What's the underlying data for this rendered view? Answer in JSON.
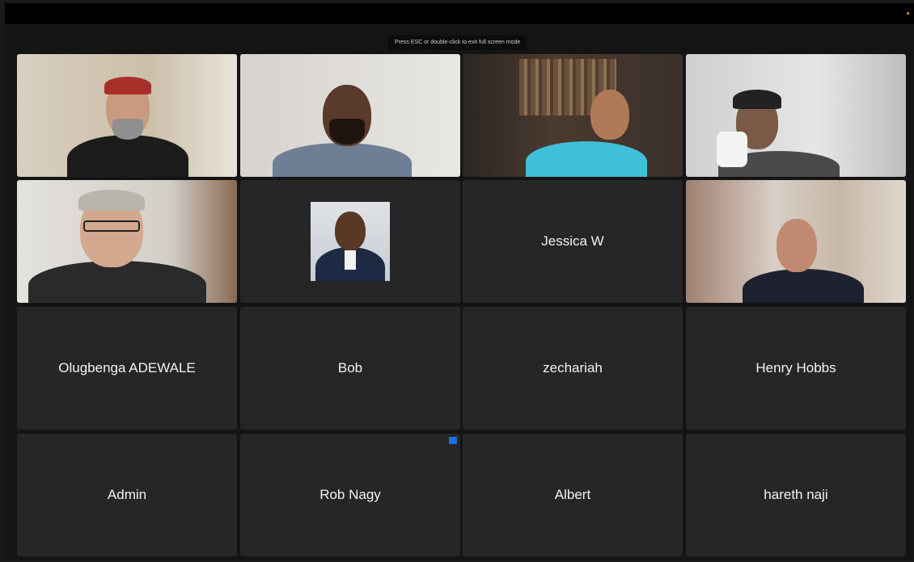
{
  "banner": "Press ESC or double-click to exit full screen mode",
  "participants": [
    {
      "name": "",
      "video": true
    },
    {
      "name": "",
      "video": true
    },
    {
      "name": "",
      "video": true
    },
    {
      "name": "",
      "video": true
    },
    {
      "name": "",
      "video": true
    },
    {
      "name": "",
      "profile_picture": true
    },
    {
      "name": "Jessica W"
    },
    {
      "name": "",
      "video": true
    },
    {
      "name": "Olugbenga ADEWALE"
    },
    {
      "name": "Bob"
    },
    {
      "name": "zechariah"
    },
    {
      "name": "Henry Hobbs"
    },
    {
      "name": "Admin"
    },
    {
      "name": "Rob Nagy"
    },
    {
      "name": "Albert"
    },
    {
      "name": "hareth naji"
    }
  ],
  "colors": {
    "active_speaker": "#3cb043",
    "tile_bg": "#262626",
    "badge": "#1e6fe0"
  }
}
